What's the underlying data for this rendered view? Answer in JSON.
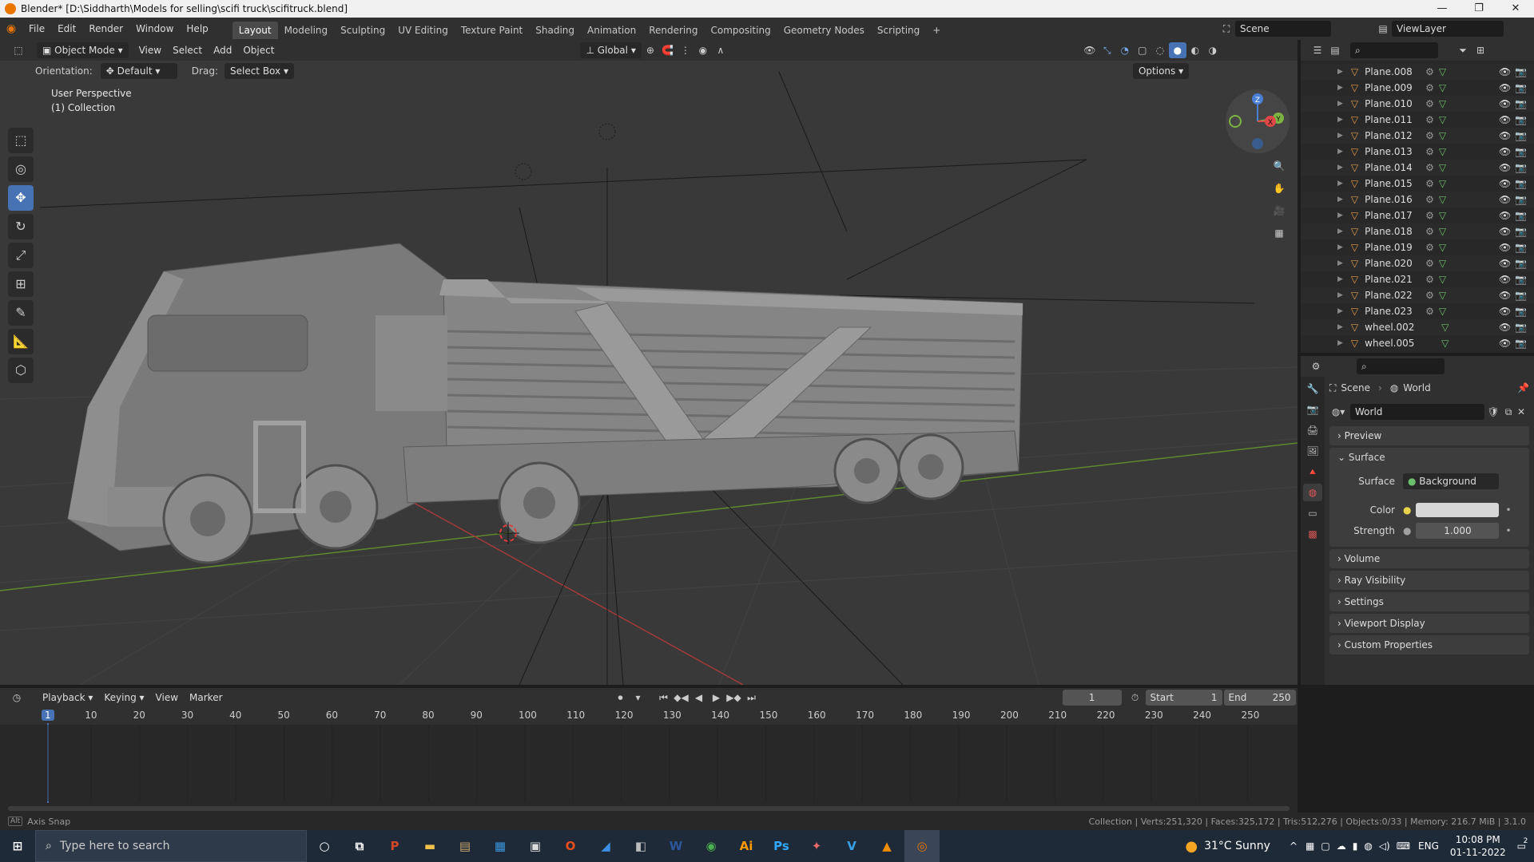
{
  "window": {
    "title": "Blender* [D:\\Siddharth\\Models for selling\\scifi truck\\scifitruck.blend]",
    "controls": [
      "—",
      "❐",
      "✕"
    ]
  },
  "menubar": {
    "items": [
      "File",
      "Edit",
      "Render",
      "Window",
      "Help"
    ],
    "workspaces": [
      "Layout",
      "Modeling",
      "Sculpting",
      "UV Editing",
      "Texture Paint",
      "Shading",
      "Animation",
      "Rendering",
      "Compositing",
      "Geometry Nodes",
      "Scripting"
    ],
    "active_workspace": "Layout",
    "add_tab": "+",
    "scene": "Scene",
    "view_layer": "ViewLayer"
  },
  "viewport": {
    "mode": "Object Mode",
    "menus": [
      "View",
      "Select",
      "Add",
      "Object"
    ],
    "transform_orientation": "Global",
    "orientation_label": "Orientation:",
    "orientation_value": "Default",
    "drag_label": "Drag:",
    "drag_value": "Select Box",
    "options": "Options",
    "perspective": "User Perspective",
    "collection": "(1) Collection",
    "gizmo_labels": {
      "z": "Z",
      "y": "Y",
      "x": "X"
    }
  },
  "outliner": {
    "items": [
      "Plane.008",
      "Plane.009",
      "Plane.010",
      "Plane.011",
      "Plane.012",
      "Plane.013",
      "Plane.014",
      "Plane.015",
      "Plane.016",
      "Plane.017",
      "Plane.018",
      "Plane.019",
      "Plane.020",
      "Plane.021",
      "Plane.022",
      "Plane.023",
      "wheel.002",
      "wheel.005"
    ]
  },
  "properties": {
    "breadcrumb_scene": "Scene",
    "breadcrumb_world": "World",
    "world_name": "World",
    "panels_top": [
      "Preview"
    ],
    "surface_panel": "Surface",
    "surface_label": "Surface",
    "surface_value": "Background",
    "color_label": "Color",
    "color_value": "#d7d7d7",
    "strength_label": "Strength",
    "strength_value": "1.000",
    "panels_bottom": [
      "Volume",
      "Ray Visibility",
      "Settings",
      "Viewport Display",
      "Custom Properties"
    ]
  },
  "timeline": {
    "menus": [
      "Playback",
      "Keying",
      "View",
      "Marker"
    ],
    "current_frame": "1",
    "start_label": "Start",
    "start": "1",
    "end_label": "End",
    "end": "250",
    "ruler": [
      "1",
      "10",
      "20",
      "30",
      "40",
      "50",
      "60",
      "70",
      "80",
      "90",
      "100",
      "110",
      "120",
      "130",
      "140",
      "150",
      "160",
      "170",
      "180",
      "190",
      "200",
      "210",
      "220",
      "230",
      "240",
      "250"
    ]
  },
  "statusbar": {
    "left_key": "Alt",
    "left": "Axis Snap",
    "right": "Collection | Verts:251,320 | Faces:325,172 | Tris:512,276 | Objects:0/33 | Memory: 216.7 MiB | 3.1.0"
  },
  "taskbar": {
    "search_placeholder": "Type here to search",
    "weather": "31°C  Sunny",
    "lang": "ENG",
    "time": "10:08 PM",
    "date": "01-11-2022",
    "notification_count": "2",
    "apps": [
      {
        "label": "P",
        "color": "#d24726"
      },
      {
        "label": "▬",
        "color": "#f0c24a"
      },
      {
        "label": "▤",
        "color": "#c9a66b"
      },
      {
        "label": "▦",
        "color": "#3a96dd"
      },
      {
        "label": "▣",
        "color": "#dcdcdc"
      },
      {
        "label": "O",
        "color": "#e74c1c"
      },
      {
        "label": "◢",
        "color": "#3a8ee6"
      },
      {
        "label": "◧",
        "color": "#bbbbbb"
      },
      {
        "label": "W",
        "color": "#2b579a"
      },
      {
        "label": "◉",
        "color": "#4caf50"
      },
      {
        "label": "Ai",
        "color": "#ff9a00"
      },
      {
        "label": "Ps",
        "color": "#31a8ff"
      },
      {
        "label": "✦",
        "color": "#e86a6a"
      },
      {
        "label": "V",
        "color": "#39a0e6"
      },
      {
        "label": "▲",
        "color": "#f08c00"
      },
      {
        "label": "◎",
        "color": "#ea7600"
      }
    ]
  }
}
